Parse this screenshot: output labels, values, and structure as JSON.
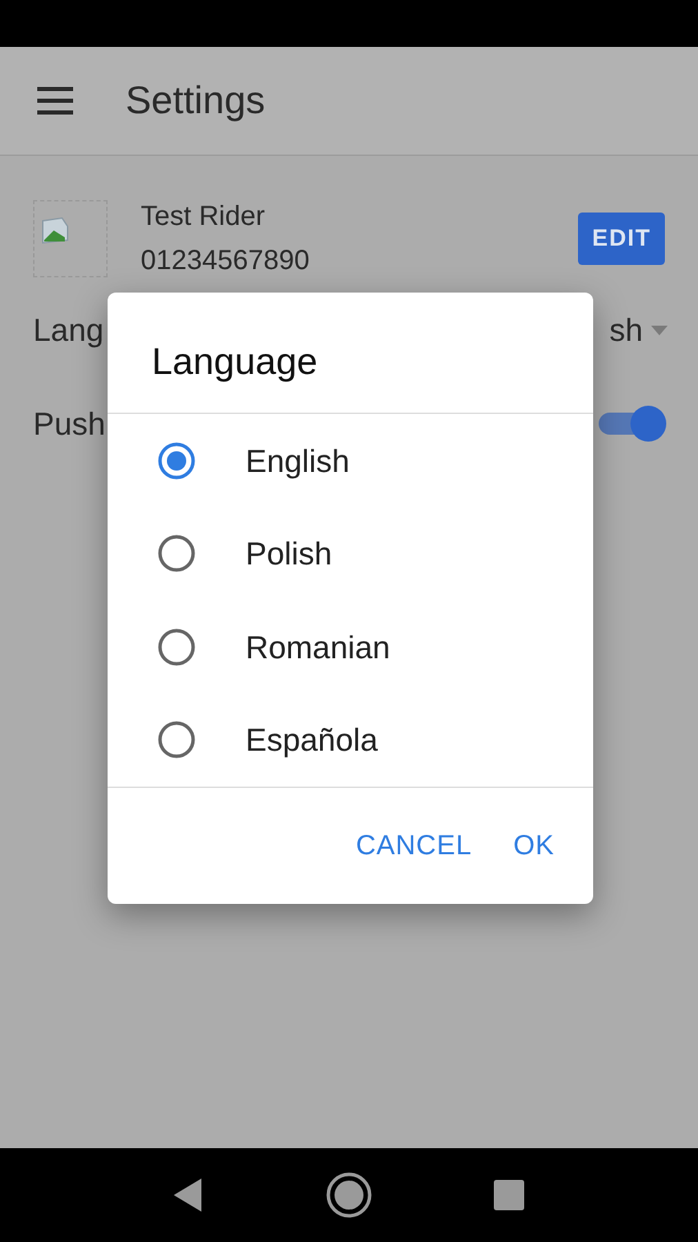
{
  "app_bar": {
    "title": "Settings"
  },
  "profile": {
    "name": "Test Rider",
    "phone": "01234567890",
    "edit_button": "EDIT"
  },
  "settings": [
    {
      "kind": "dropdown",
      "label": "Lang",
      "value": "sh"
    },
    {
      "kind": "toggle",
      "label": "Push",
      "on": true
    }
  ],
  "dialog": {
    "title": "Language",
    "options": [
      {
        "label": "English",
        "selected": true
      },
      {
        "label": "Polish",
        "selected": false
      },
      {
        "label": "Romanian",
        "selected": false
      },
      {
        "label": "Española",
        "selected": false
      }
    ],
    "buttons": [
      "CANCEL",
      "OK"
    ]
  }
}
